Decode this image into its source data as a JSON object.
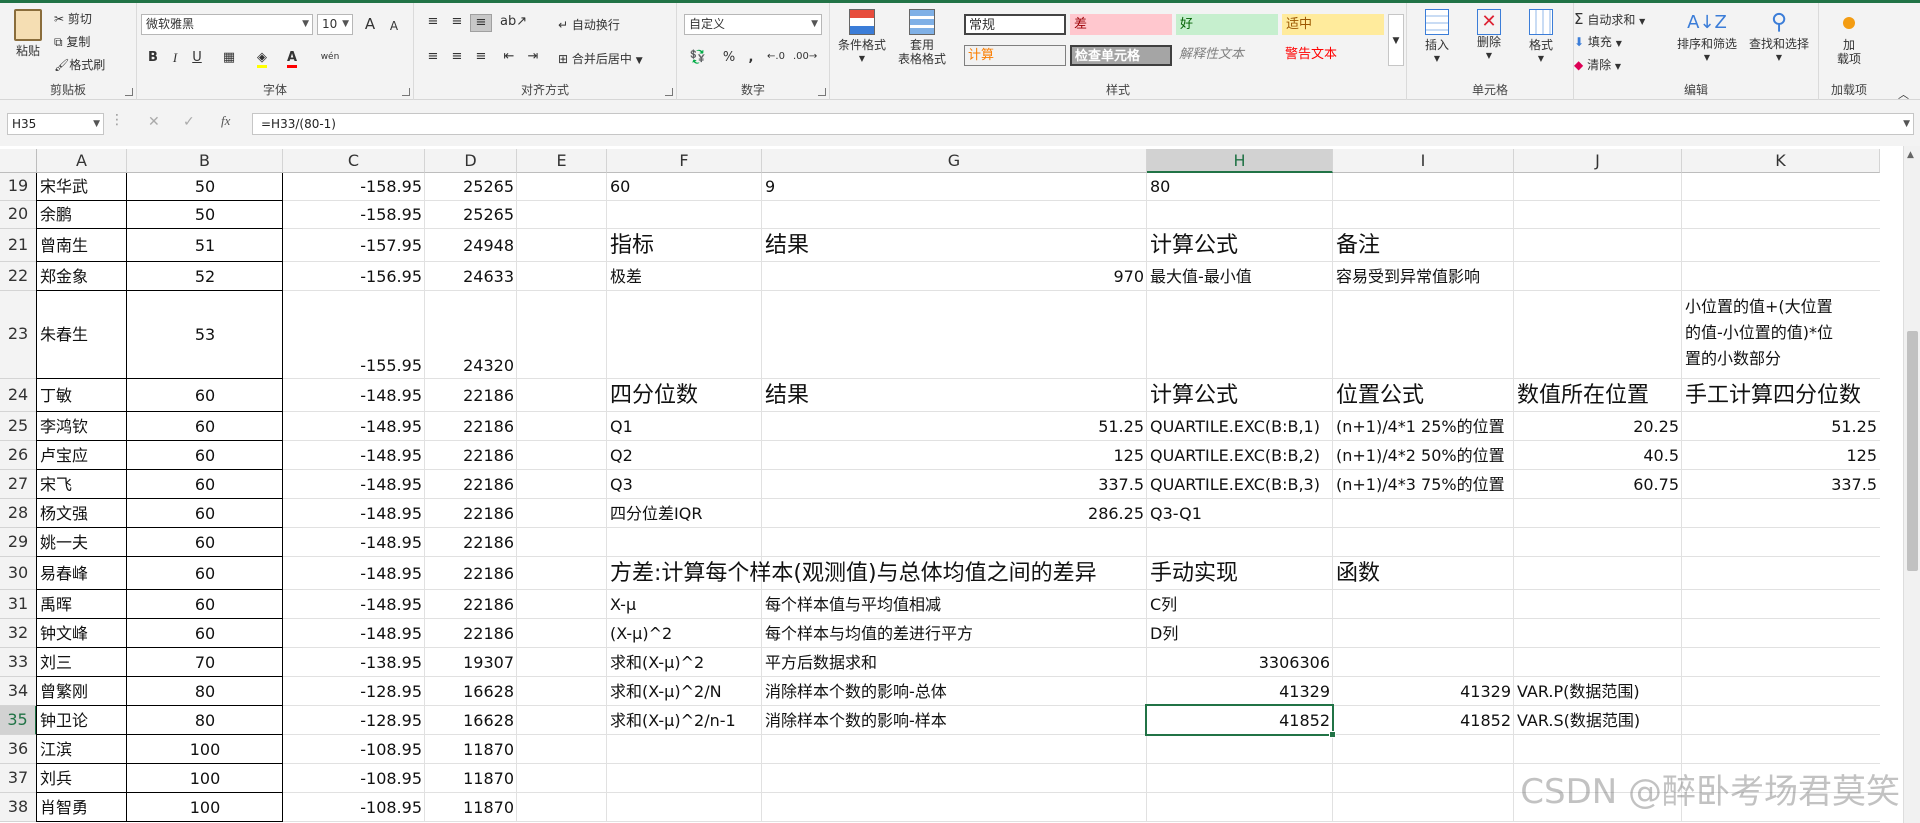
{
  "ribbon": {
    "clipboard": {
      "paste": "粘贴",
      "cut": "剪切",
      "copy": "复制",
      "format_painter": "格式刷",
      "label": "剪贴板"
    },
    "font": {
      "name": "微软雅黑",
      "size": "10",
      "bold": "B",
      "italic": "I",
      "underline": "U",
      "phonetic": "wén",
      "label": "字体",
      "increase": "A",
      "decrease": "A"
    },
    "alignment": {
      "wrap": "自动换行",
      "merge": "合并后居中",
      "label": "对齐方式"
    },
    "number": {
      "format": "自定义",
      "percent": "%",
      "comma": ",",
      "label": "数字"
    },
    "styles": {
      "conditional": "条件格式",
      "table_line1": "套用",
      "table_line2": "表格格式",
      "normal": "常规",
      "bad": "差",
      "good": "好",
      "neutral": "适中",
      "calc": "计算",
      "check": "检查单元格",
      "explain": "解释性文本",
      "warning": "警告文本",
      "label": "样式"
    },
    "cells": {
      "insert": "插入",
      "delete": "删除",
      "format": "格式",
      "label": "单元格"
    },
    "editing": {
      "autosum": "自动求和",
      "fill": "填充",
      "clear": "清除",
      "sort": "排序和筛选",
      "find": "查找和选择",
      "label": "编辑"
    },
    "addins": {
      "line1": "加",
      "line2": "载项",
      "label": "加载项"
    }
  },
  "formula_bar": {
    "name_box": "H35",
    "fx": "fx",
    "formula": "=H33/(80-1)"
  },
  "columns": [
    "A",
    "B",
    "C",
    "D",
    "E",
    "F",
    "G",
    "H",
    "I",
    "J",
    "K"
  ],
  "rows": [
    {
      "n": "19",
      "A": "宋华武",
      "B": "50",
      "C": "-158.95",
      "D": "25265",
      "F": "60",
      "G": "9",
      "H": "80"
    },
    {
      "n": "20",
      "A": "余鹏",
      "B": "50",
      "C": "-158.95",
      "D": "25265"
    },
    {
      "n": "21",
      "A": "曾南生",
      "B": "51",
      "C": "-157.95",
      "D": "24948",
      "F": "指标",
      "G": "结果",
      "H": "计算公式",
      "I": "备注"
    },
    {
      "n": "22",
      "A": "郑金象",
      "B": "52",
      "C": "-156.95",
      "D": "24633",
      "F": "极差",
      "G": "970",
      "H": "最大值-最小值",
      "I": "容易受到异常值影响"
    },
    {
      "n": "23",
      "A": "朱春生",
      "B": "53",
      "C": "-155.95",
      "D": "24320",
      "K1": "小位置的值+(大位置",
      "K2": "的值-小位置的值)*位",
      "K3": "置的小数部分"
    },
    {
      "n": "24",
      "A": "丁敏",
      "B": "60",
      "C": "-148.95",
      "D": "22186",
      "F": "四分位数",
      "G": "结果",
      "H": "计算公式",
      "I": "位置公式",
      "J": "数值所在位置",
      "K": "手工计算四分位数"
    },
    {
      "n": "25",
      "A": "李鸿钦",
      "B": "60",
      "C": "-148.95",
      "D": "22186",
      "F": "Q1",
      "G": "51.25",
      "H": "QUARTILE.EXC(B:B,1)",
      "I": "(n+1)/4*1  25%的位置",
      "J": "20.25",
      "K": "51.25"
    },
    {
      "n": "26",
      "A": "卢宝应",
      "B": "60",
      "C": "-148.95",
      "D": "22186",
      "F": "Q2",
      "G": "125",
      "H": "QUARTILE.EXC(B:B,2)",
      "I": "(n+1)/4*2  50%的位置",
      "J": "40.5",
      "K": "125"
    },
    {
      "n": "27",
      "A": "宋飞",
      "B": "60",
      "C": "-148.95",
      "D": "22186",
      "F": "Q3",
      "G": "337.5",
      "H": "QUARTILE.EXC(B:B,3)",
      "I": "(n+1)/4*3  75%的位置",
      "J": "60.75",
      "K": "337.5"
    },
    {
      "n": "28",
      "A": "杨文强",
      "B": "60",
      "C": "-148.95",
      "D": "22186",
      "F": "四分位差IQR",
      "G": "286.25",
      "H": "Q3-Q1"
    },
    {
      "n": "29",
      "A": "姚一夫",
      "B": "60",
      "C": "-148.95",
      "D": "22186"
    },
    {
      "n": "30",
      "A": "易春峰",
      "B": "60",
      "C": "-148.95",
      "D": "22186",
      "F": "方差:计算每个样本(观测值)与总体均值之间的差异",
      "H": "手动实现",
      "I": "函数"
    },
    {
      "n": "31",
      "A": "禹晖",
      "B": "60",
      "C": "-148.95",
      "D": "22186",
      "F": "X-μ",
      "G": "每个样本值与平均值相减",
      "H": "C列"
    },
    {
      "n": "32",
      "A": "钟文峰",
      "B": "60",
      "C": "-148.95",
      "D": "22186",
      "F": "(X-μ)^2",
      "G": "每个样本与均值的差进行平方",
      "H": "D列"
    },
    {
      "n": "33",
      "A": "刘三",
      "B": "70",
      "C": "-138.95",
      "D": "19307",
      "F": "求和(X-μ)^2",
      "G": "平方后数据求和",
      "H": "3306306"
    },
    {
      "n": "34",
      "A": "曾繁刚",
      "B": "80",
      "C": "-128.95",
      "D": "16628",
      "F": "求和(X-μ)^2/N",
      "G": "消除样本个数的影响-总体",
      "H": "41329",
      "I": "41329",
      "J": "VAR.P(数据范围)"
    },
    {
      "n": "35",
      "A": "钟卫论",
      "B": "80",
      "C": "-128.95",
      "D": "16628",
      "F": "求和(X-μ)^2/n-1",
      "G": "消除样本个数的影响-样本",
      "H": "41852",
      "I": "41852",
      "J": "VAR.S(数据范围)"
    },
    {
      "n": "36",
      "A": "江滨",
      "B": "100",
      "C": "-108.95",
      "D": "11870"
    },
    {
      "n": "37",
      "A": "刘兵",
      "B": "100",
      "C": "-108.95",
      "D": "11870"
    },
    {
      "n": "38",
      "A": "肖智勇",
      "B": "100",
      "C": "-108.95",
      "D": "11870"
    }
  ],
  "watermark": "CSDN @醉卧考场君莫笑",
  "colors": {
    "accent": "#217346",
    "bad_bg": "#ffc7ce",
    "bad_fg": "#9c0006",
    "good_bg": "#c6efce",
    "good_fg": "#006100",
    "neutral_bg": "#ffeb9c",
    "neutral_fg": "#9c5700",
    "calc_fg": "#fa7d00",
    "check_bg": "#a5a5a5",
    "warning_fg": "#ff0000"
  }
}
